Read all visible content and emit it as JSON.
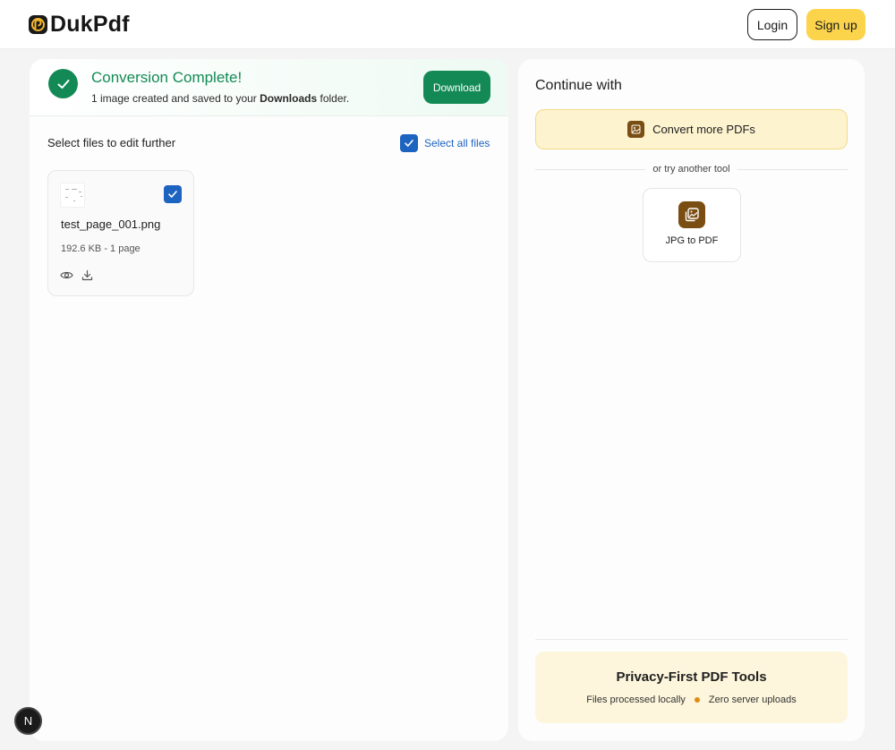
{
  "header": {
    "brand": "DukPdf",
    "login_label": "Login",
    "signup_label": "Sign up"
  },
  "banner": {
    "title": "Conversion Complete!",
    "subtitle_prefix": "1 image created and saved to your",
    "subtitle_bold": "Downloads",
    "subtitle_suffix": "folder.",
    "download_label": "Download"
  },
  "files": {
    "section_label": "Select files to edit further",
    "select_all_label": "Select all files",
    "select_all_checked": true,
    "items": [
      {
        "name": "test_page_001.png",
        "meta": "192.6 KB - 1 page",
        "checked": true
      }
    ]
  },
  "continue": {
    "title": "Continue with",
    "primary_label": "Convert more PDFs",
    "divider_text": "or try another tool",
    "tools": [
      {
        "label": "JPG to PDF",
        "icon": "images-icon"
      }
    ]
  },
  "privacy": {
    "title": "Privacy-First PDF Tools",
    "points": [
      "Files processed locally",
      "Zero server uploads"
    ]
  },
  "dev_badge": "N",
  "colors": {
    "accent_green": "#138a55",
    "accent_blue": "#1d63c0",
    "accent_yellow": "#fbd44c",
    "tool_brown": "#7a4e13"
  }
}
